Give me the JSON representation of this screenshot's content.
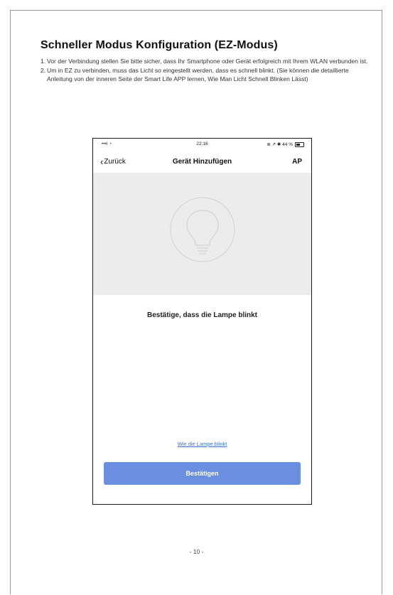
{
  "doc": {
    "heading": "Schneller Modus Konfiguration (EZ-Modus)",
    "steps": [
      {
        "num": "1.",
        "text": "Vor der Verbindung stellen Sie bitte sicher, dass Ihr Smartphone oder Gerät erfolgreich mit Ihrem WLAN verbunden ist."
      },
      {
        "num": "2.",
        "text": "Um in EZ zu verbinden, muss das Licht so eingestellt werden, dass es schnell blinkt. (Sie können die detaillierte Anleitung von der inneren Seite der Smart Life APP lernen, Wie Man Licht Schnell Blinken Lässt)"
      }
    ],
    "page_number": "- 10 -"
  },
  "phone": {
    "status": {
      "left": "•••l ◔",
      "time": "22:16",
      "right": "⊕ ↗ ✱ 44 %"
    },
    "nav": {
      "back_chevron": "‹",
      "back_label": "Zurück",
      "title": "Gerät Hinzufügen",
      "right_label": "AP"
    },
    "message": "Bestätige, dass die Lampe blinkt",
    "help_link": "Wie die Lampe blinkt",
    "confirm_button": "Bestätigen",
    "icons": {
      "hero": "lightbulb-icon",
      "back": "chevron-left-icon",
      "battery": "battery-icon"
    },
    "colors": {
      "accent": "#6b8fe0",
      "link": "#3a6fd8",
      "hero_bg": "#ececec"
    }
  }
}
